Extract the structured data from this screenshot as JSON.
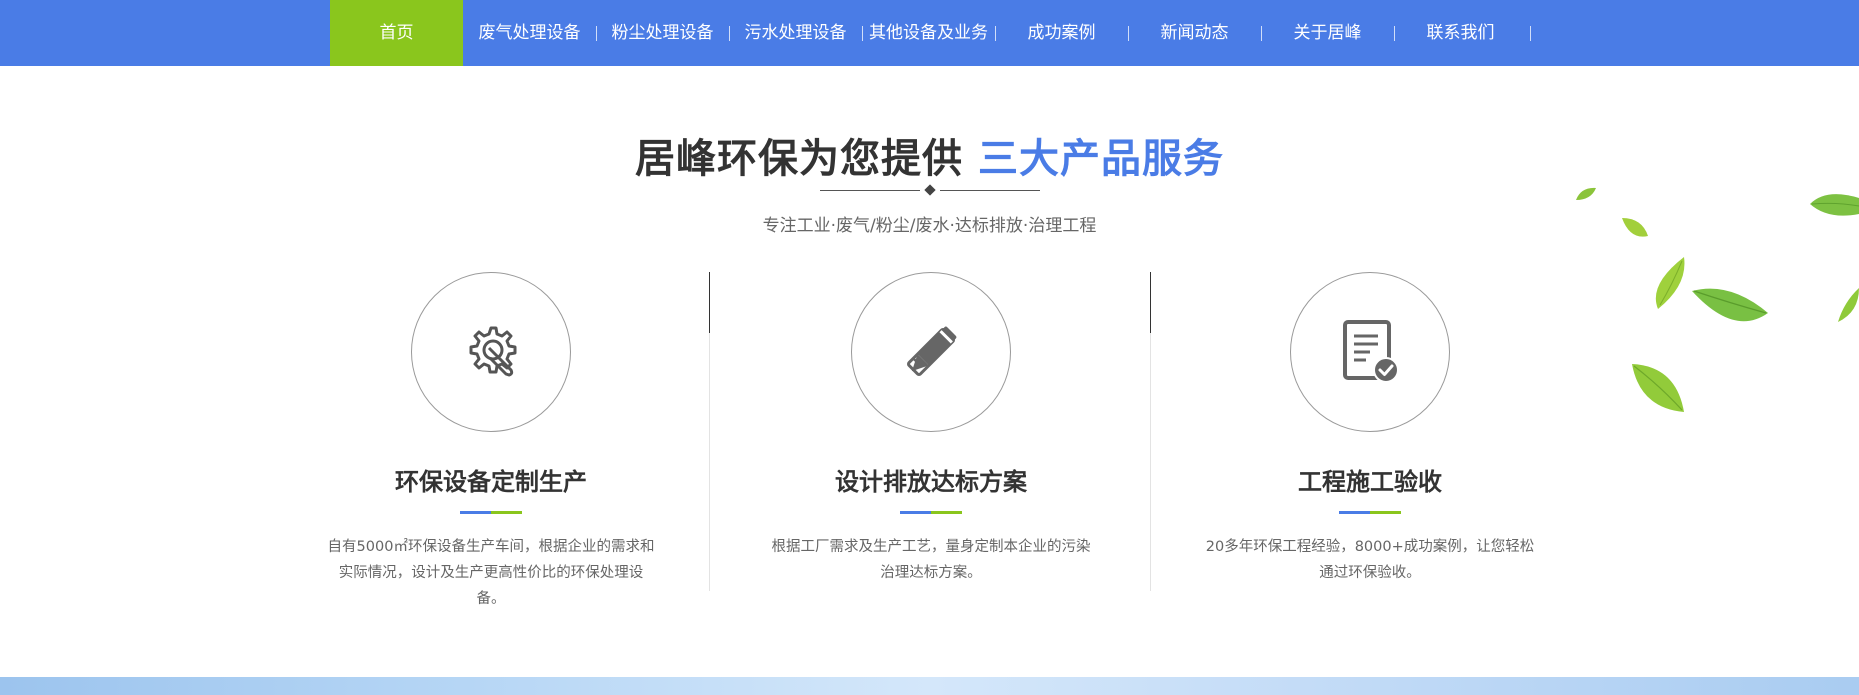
{
  "nav": {
    "items": [
      {
        "label": "首页",
        "active": true
      },
      {
        "label": "废气处理设备"
      },
      {
        "label": "粉尘处理设备"
      },
      {
        "label": "污水处理设备"
      },
      {
        "label": "其他设备及业务"
      },
      {
        "label": "成功案例"
      },
      {
        "label": "新闻动态"
      },
      {
        "label": "关于居峰"
      },
      {
        "label": "联系我们"
      }
    ]
  },
  "section": {
    "title_main": "居峰环保为您提供",
    "title_accent": "三大产品服务",
    "subtitle": "专注工业·废气/粉尘/废水·达标排放·治理工程"
  },
  "cards": [
    {
      "icon": "gear-wrench-icon",
      "title": "环保设备定制生产",
      "desc": "自有5000㎡环保设备生产车间，根据企业的需求和实际情况，设计及生产更高性价比的环保处理设备。"
    },
    {
      "icon": "pencil-ruler-icon",
      "title": "设计排放达标方案",
      "desc": "根据工厂需求及生产工艺，量身定制本企业的污染治理达标方案。"
    },
    {
      "icon": "document-check-icon",
      "title": "工程施工验收",
      "desc": "20多年环保工程经验，8000+成功案例，让您轻松通过环保验收。"
    }
  ],
  "colors": {
    "brand_blue": "#4a7ce6",
    "brand_green": "#8ac61d",
    "text_dark": "#333333",
    "text_muted": "#666666"
  }
}
